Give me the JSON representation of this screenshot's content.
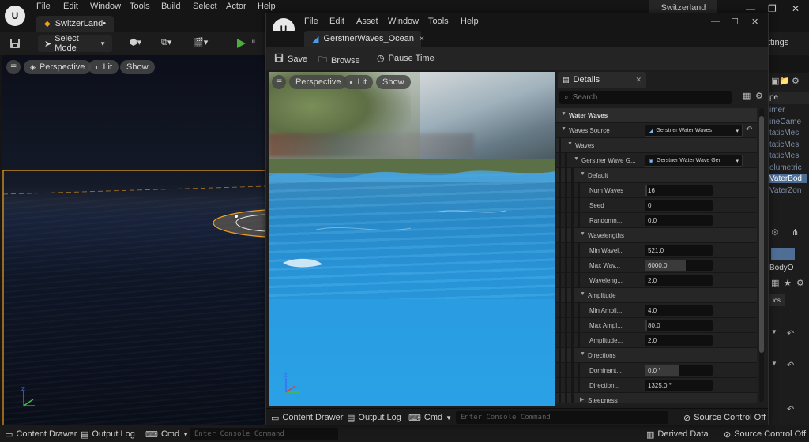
{
  "main": {
    "menu": [
      "File",
      "Edit",
      "Window",
      "Tools",
      "Build",
      "Select",
      "Actor",
      "Help"
    ],
    "project_name": "Switzerland",
    "level_tab": "SwitzerLand•",
    "toolbar": {
      "select_mode": "Select Mode",
      "settings": "ttings"
    },
    "viewport": {
      "perspective": "Perspective",
      "lit": "Lit",
      "show": "Show"
    },
    "right_panel": {
      "header": "pe",
      "items": [
        "imer",
        "ineCame",
        "taticMes",
        "taticMes",
        "taticMes",
        "olumetric",
        "VaterBod",
        "VaterZon"
      ],
      "selected_index": 6,
      "lower_text": "BodyO",
      "lower_button": "ics"
    },
    "statusbar": {
      "content_drawer": "Content Drawer",
      "output_log": "Output Log",
      "cmd": "Cmd",
      "console_placeholder": "Enter Console Command",
      "derived_data": "Derived Data",
      "source_control": "Source Control Off"
    }
  },
  "asset": {
    "menu": [
      "File",
      "Edit",
      "Asset",
      "Window",
      "Tools",
      "Help"
    ],
    "tab": "GerstnerWaves_Ocean",
    "toolbar": {
      "save": "Save",
      "browse": "Browse",
      "pause": "Pause Time"
    },
    "viewport": {
      "perspective": "Perspective",
      "lit": "Lit",
      "show": "Show"
    },
    "statusbar": {
      "content_drawer": "Content Drawer",
      "output_log": "Output Log",
      "cmd": "Cmd",
      "console_placeholder": "Enter Console Command",
      "source_control": "Source Control Off"
    }
  },
  "details": {
    "tab": "Details",
    "search_placeholder": "Search",
    "rows": [
      {
        "kind": "cat",
        "label": "Water Waves",
        "depth": 0
      },
      {
        "kind": "combo",
        "label": "Waves Source",
        "value": "Gerstner Water Waves",
        "depth": 0
      },
      {
        "kind": "sub",
        "label": "Waves",
        "depth": 1
      },
      {
        "kind": "combo2",
        "label": "Gerstner Wave G...",
        "value": "Gerstner Water Wave Gen",
        "depth": 2
      },
      {
        "kind": "sub",
        "label": "Default",
        "depth": 3
      },
      {
        "kind": "prop",
        "label": "Num Waves",
        "value": "16",
        "fill": 0.04,
        "depth": 4
      },
      {
        "kind": "prop",
        "label": "Seed",
        "value": "0",
        "fill": 0,
        "depth": 4
      },
      {
        "kind": "prop",
        "label": "Randomn...",
        "value": "0.0",
        "fill": 0,
        "depth": 4
      },
      {
        "kind": "sub",
        "label": "Wavelengths",
        "depth": 3
      },
      {
        "kind": "prop",
        "label": "Min Wavel...",
        "value": "521.0",
        "fill": 0,
        "depth": 4
      },
      {
        "kind": "prop",
        "label": "Max Wav...",
        "value": "6000.0",
        "fill": 0.6,
        "depth": 4
      },
      {
        "kind": "prop",
        "label": "Waveleng...",
        "value": "2.0",
        "fill": 0,
        "depth": 4
      },
      {
        "kind": "sub",
        "label": "Amplitude",
        "depth": 3
      },
      {
        "kind": "prop",
        "label": "Min Ampli...",
        "value": "4.0",
        "fill": 0,
        "depth": 4
      },
      {
        "kind": "prop",
        "label": "Max Ampl...",
        "value": "80.0",
        "fill": 0.04,
        "depth": 4
      },
      {
        "kind": "prop",
        "label": "Amplitude...",
        "value": "2.0",
        "fill": 0,
        "depth": 4
      },
      {
        "kind": "sub",
        "label": "Directions",
        "depth": 3
      },
      {
        "kind": "prop",
        "label": "Dominant...",
        "value": "0.0 °",
        "fill": 0.5,
        "depth": 4
      },
      {
        "kind": "prop",
        "label": "Direction...",
        "value": "1325.0 °",
        "fill": 0,
        "depth": 4
      },
      {
        "kind": "sub-collapsed",
        "label": "Steepness",
        "depth": 3
      }
    ]
  },
  "colors": {
    "accent_orange": "#f0a020",
    "selection_blue": "#4e6e96",
    "play_green": "#4caf3a",
    "water_blue": "#2a9be0"
  }
}
